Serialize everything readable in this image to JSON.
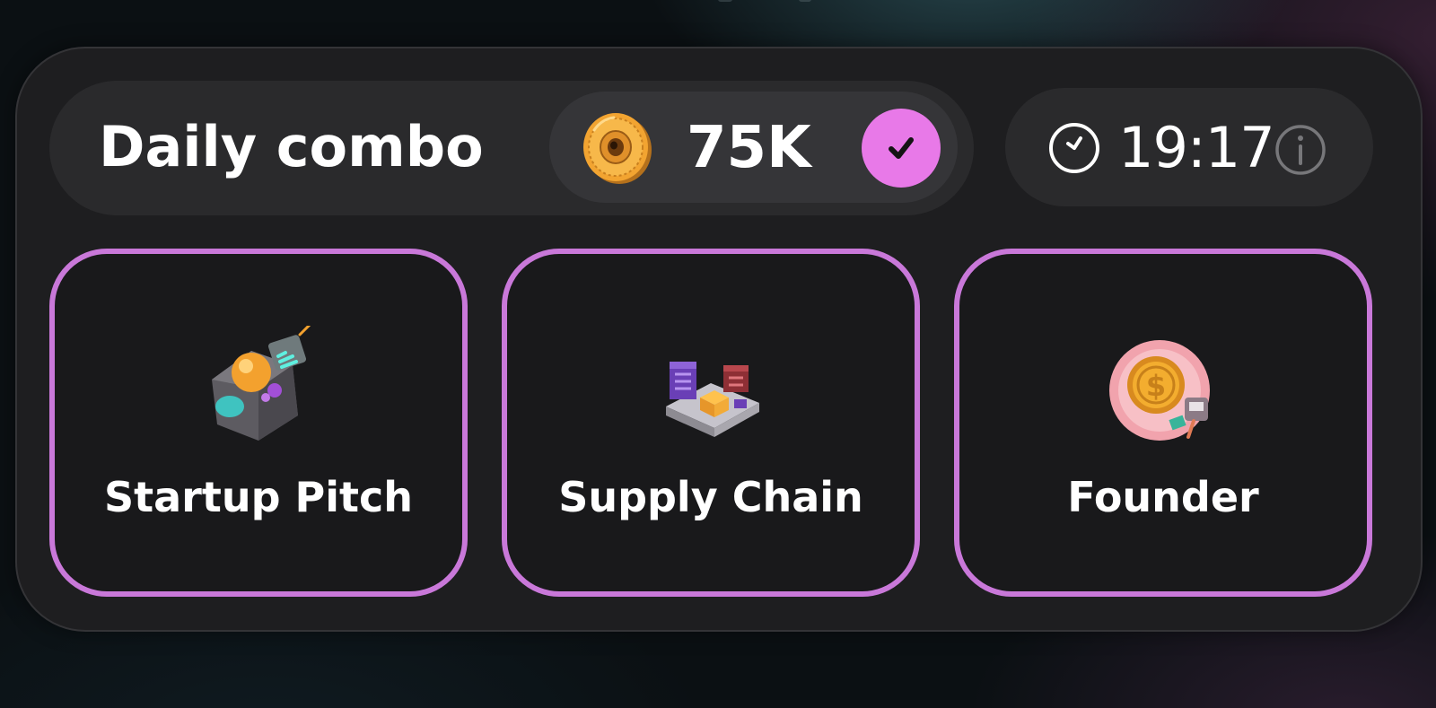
{
  "daily_combo": {
    "title": "Daily combo",
    "reward": {
      "amount": "75K",
      "coin_icon": "coin-icon",
      "claimed": true,
      "claimed_icon": "checkmark-icon",
      "claimed_badge_color": "#e879e8"
    },
    "timer": {
      "clock_icon": "clock-icon",
      "value": "19:17",
      "info_icon": "info-icon"
    },
    "cards": [
      {
        "label": "Startup Pitch",
        "image": "startup-pitch-illustration"
      },
      {
        "label": "Supply Chain",
        "image": "supply-chain-illustration"
      },
      {
        "label": "Founder",
        "image": "founder-illustration"
      }
    ],
    "card_border_color": "#c978d9"
  }
}
